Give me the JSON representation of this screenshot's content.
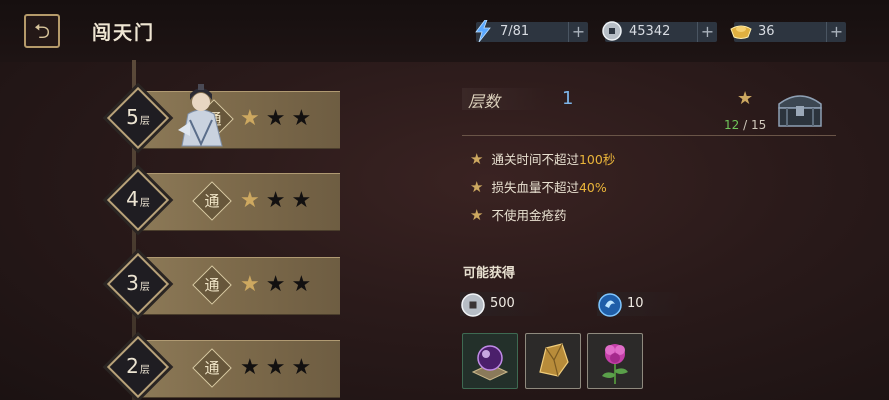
{
  "header": {
    "title": "闯天门"
  },
  "resources": [
    {
      "name": "stamina",
      "value": "7/81",
      "icon": "lightning-icon",
      "color": "#5aa8ff"
    },
    {
      "name": "silver",
      "value": "45342",
      "icon": "silver-coin-icon",
      "color": "#c8d0d8"
    },
    {
      "name": "gold-ingot",
      "value": "36",
      "icon": "gold-ingot-icon",
      "color": "#e0b040"
    }
  ],
  "floors": [
    {
      "num": "5",
      "unit": "层",
      "seal": "通",
      "stars_earned": 1,
      "stars_total": 3,
      "current": true
    },
    {
      "num": "4",
      "unit": "层",
      "seal": "通",
      "stars_earned": 1,
      "stars_total": 3
    },
    {
      "num": "3",
      "unit": "层",
      "seal": "通",
      "stars_earned": 1,
      "stars_total": 3
    },
    {
      "num": "2",
      "unit": "层",
      "seal": "通",
      "stars_earned": 0,
      "stars_total": 3
    }
  ],
  "detail": {
    "floor_label": "层数",
    "floor_value": "1",
    "chest_progress_current": "12",
    "chest_progress_sep": "/",
    "chest_progress_total": "15",
    "conditions": [
      {
        "prefix": "通关时间不超过",
        "highlight": "100秒",
        "suffix": ""
      },
      {
        "prefix": "损失血量不超过",
        "highlight": "40%",
        "suffix": ""
      },
      {
        "prefix": "不使用金疮药",
        "highlight": "",
        "suffix": ""
      }
    ],
    "rewards_title": "可能获得",
    "currency_rewards": [
      {
        "value": "500",
        "icon": "silver-coin-icon"
      },
      {
        "value": "10",
        "icon": "blue-spirit-orb-icon"
      }
    ],
    "item_rewards": [
      {
        "icon": "purple-orb-icon",
        "border": "#3e6a52"
      },
      {
        "icon": "gold-ore-icon",
        "border": "#5a5854"
      },
      {
        "icon": "purple-flower-icon",
        "border": "#5a5854"
      }
    ]
  },
  "colors": {
    "accent_gold": "#cda860",
    "highlight": "#e9b43a",
    "floor_value": "#7cb4e8",
    "progress_current": "#6fc45a"
  }
}
